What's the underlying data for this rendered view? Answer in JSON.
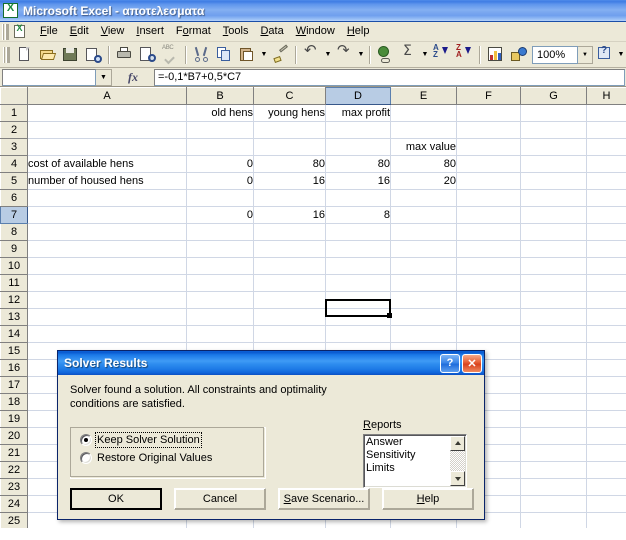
{
  "window": {
    "title": "Microsoft Excel - αποτελεσματα",
    "app_icon": "excel-icon"
  },
  "menu": {
    "items": [
      {
        "label": "File",
        "accel": "F"
      },
      {
        "label": "Edit",
        "accel": "E"
      },
      {
        "label": "View",
        "accel": "V"
      },
      {
        "label": "Insert",
        "accel": "I"
      },
      {
        "label": "Format",
        "accel": "o"
      },
      {
        "label": "Tools",
        "accel": "T"
      },
      {
        "label": "Data",
        "accel": "D"
      },
      {
        "label": "Window",
        "accel": "W"
      },
      {
        "label": "Help",
        "accel": "H"
      }
    ]
  },
  "toolbar": {
    "buttons": [
      "new-icon",
      "open-icon",
      "save-icon",
      "print-search-icon",
      "print-icon",
      "print-preview-icon",
      "spelling-icon",
      "cut-icon",
      "copy-icon",
      "paste-icon",
      "format-painter-icon",
      "undo-icon",
      "redo-icon",
      "hyperlink-icon",
      "autosum-icon",
      "sort-ascending-icon",
      "sort-descending-icon",
      "chart-wizard-icon",
      "drawing-icon",
      "help-icon"
    ],
    "zoom_value": "100%"
  },
  "formula_bar": {
    "name_box_value": "",
    "fx_label": "fx",
    "formula": "=-0,1*B7+0,5*C7"
  },
  "sheet": {
    "columns": [
      "A",
      "B",
      "C",
      "D",
      "E",
      "F",
      "G",
      "H"
    ],
    "selected_column": "D",
    "selected_row": "7",
    "selected_cell": "D7",
    "rows": [
      {
        "num": "1",
        "cells": [
          "",
          "old hens",
          "young hens",
          "max profit",
          "",
          "",
          "",
          ""
        ]
      },
      {
        "num": "2",
        "cells": [
          "",
          "",
          "",
          "",
          "",
          "",
          "",
          ""
        ]
      },
      {
        "num": "3",
        "cells": [
          "",
          "",
          "",
          "",
          "max value",
          "",
          "",
          ""
        ]
      },
      {
        "num": "4",
        "cells": [
          "cost of available hens",
          "0",
          "80",
          "80",
          "80",
          "",
          "",
          ""
        ]
      },
      {
        "num": "5",
        "cells": [
          "number of housed hens",
          "0",
          "16",
          "16",
          "20",
          "",
          "",
          ""
        ]
      },
      {
        "num": "6",
        "cells": [
          "",
          "",
          "",
          "",
          "",
          "",
          "",
          ""
        ]
      },
      {
        "num": "7",
        "cells": [
          "",
          "0",
          "16",
          "8",
          "",
          "",
          "",
          ""
        ]
      },
      {
        "num": "8",
        "cells": [
          "",
          "",
          "",
          "",
          "",
          "",
          "",
          ""
        ]
      },
      {
        "num": "9",
        "cells": [
          "",
          "",
          "",
          "",
          "",
          "",
          "",
          ""
        ]
      },
      {
        "num": "10",
        "cells": [
          "",
          "",
          "",
          "",
          "",
          "",
          "",
          ""
        ]
      },
      {
        "num": "11",
        "cells": [
          "",
          "",
          "",
          "",
          "",
          "",
          "",
          ""
        ]
      },
      {
        "num": "12",
        "cells": [
          "",
          "",
          "",
          "",
          "",
          "",
          "",
          ""
        ]
      },
      {
        "num": "13",
        "cells": [
          "",
          "",
          "",
          "",
          "",
          "",
          "",
          ""
        ]
      },
      {
        "num": "14",
        "cells": [
          "",
          "",
          "",
          "",
          "",
          "",
          "",
          ""
        ]
      },
      {
        "num": "15",
        "cells": [
          "",
          "",
          "",
          "",
          "",
          "",
          "",
          ""
        ]
      },
      {
        "num": "16",
        "cells": [
          "",
          "",
          "",
          "",
          "",
          "",
          "",
          ""
        ]
      },
      {
        "num": "17",
        "cells": [
          "",
          "",
          "",
          "",
          "",
          "",
          "",
          ""
        ]
      },
      {
        "num": "18",
        "cells": [
          "",
          "",
          "",
          "",
          "",
          "",
          "",
          ""
        ]
      },
      {
        "num": "19",
        "cells": [
          "",
          "",
          "",
          "",
          "",
          "",
          "",
          ""
        ]
      },
      {
        "num": "20",
        "cells": [
          "",
          "",
          "",
          "",
          "",
          "",
          "",
          ""
        ]
      },
      {
        "num": "21",
        "cells": [
          "",
          "",
          "",
          "",
          "",
          "",
          "",
          ""
        ]
      },
      {
        "num": "22",
        "cells": [
          "",
          "",
          "",
          "",
          "",
          "",
          "",
          ""
        ]
      },
      {
        "num": "23",
        "cells": [
          "",
          "",
          "",
          "",
          "",
          "",
          "",
          ""
        ]
      },
      {
        "num": "24",
        "cells": [
          "",
          "",
          "",
          "",
          "",
          "",
          "",
          ""
        ]
      },
      {
        "num": "25",
        "cells": [
          "",
          "",
          "",
          "",
          "",
          "",
          "",
          ""
        ]
      }
    ],
    "numeric_columns": [
      1,
      2,
      3,
      4,
      5,
      6,
      7
    ]
  },
  "dialog": {
    "title": "Solver Results",
    "help_button": "?",
    "close_button": "✕",
    "message": "Solver found a solution.  All constraints and optimality conditions are satisfied.",
    "radios": [
      {
        "label": "Keep Solver Solution",
        "checked": true,
        "focused": true
      },
      {
        "label": "Restore Original Values",
        "checked": false,
        "focused": false
      }
    ],
    "reports_label": "Reports",
    "reports": [
      "Answer",
      "Sensitivity",
      "Limits"
    ],
    "buttons": [
      {
        "label": "OK",
        "default": true
      },
      {
        "label": "Cancel",
        "default": false
      },
      {
        "label": "Save Scenario...",
        "default": false
      },
      {
        "label": "Help",
        "default": false
      }
    ]
  },
  "colors": {
    "title_blue": "#85b0f2",
    "dialog_blue": "#2e8def",
    "face": "#ece9d8",
    "selected_header": "#b8cce4",
    "grid_line": "#d0d7e5"
  }
}
